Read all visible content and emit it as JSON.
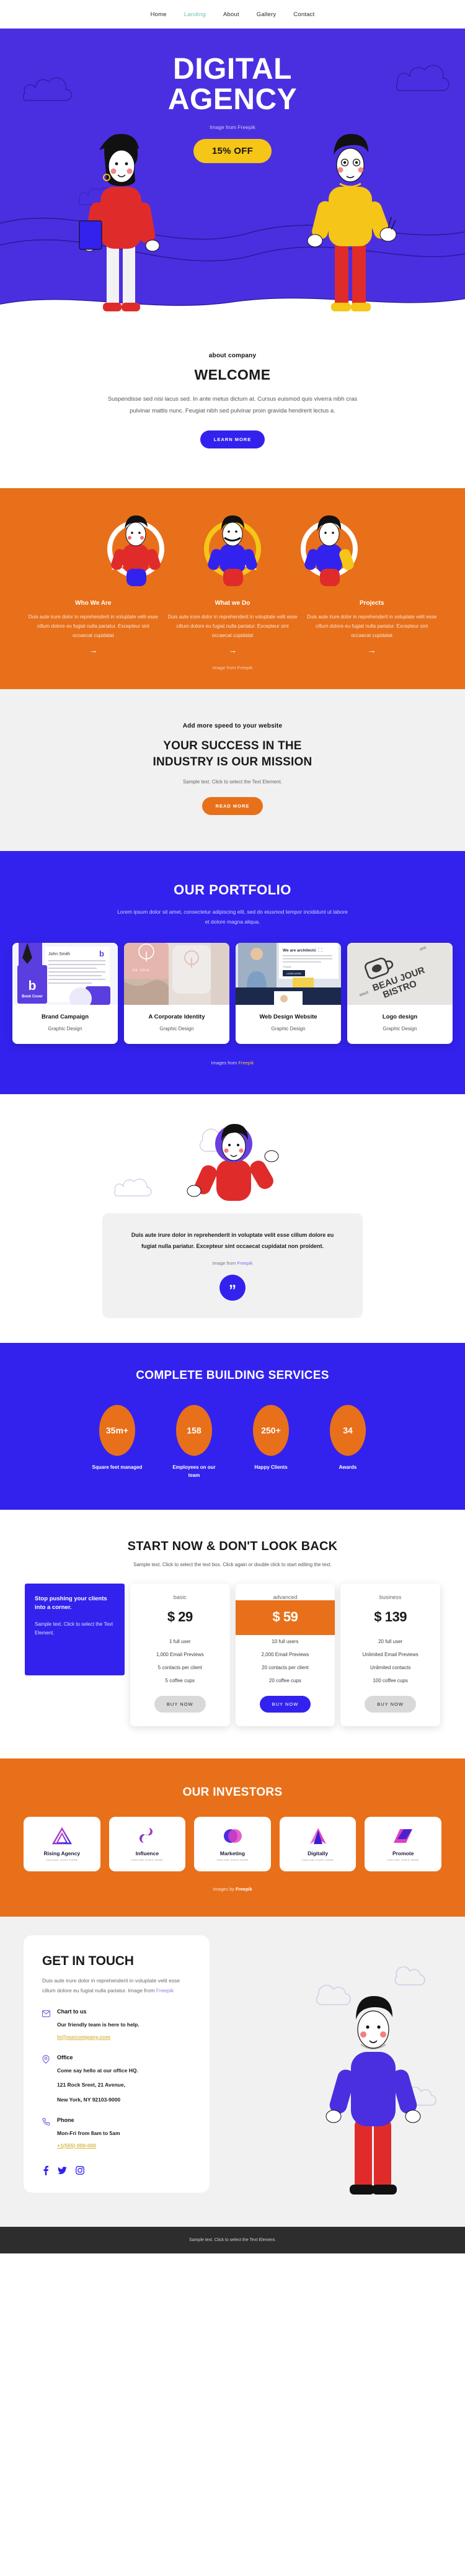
{
  "nav": {
    "items": [
      {
        "label": "Home",
        "active": false
      },
      {
        "label": "Landing",
        "active": true
      },
      {
        "label": "About",
        "active": false
      },
      {
        "label": "Gallery",
        "active": false
      },
      {
        "label": "Contact",
        "active": false
      }
    ]
  },
  "hero": {
    "title_line1": "DIGITAL",
    "title_line2": "AGENCY",
    "credit": "Image from Freepik",
    "badge": "15% OFF",
    "bg_color": "#4a2fe0",
    "badge_color": "#f5c518"
  },
  "welcome": {
    "eyebrow": "about company",
    "heading": "WELCOME",
    "body": "Suspendisse sed nisi lacus sed. In ante metus dictum at. Cursus euismod quis viverra nibh cras pulvinar mattis nunc. Feugiat nibh sed pulvinar proin gravida hendrerit lectus a.",
    "button": "LEARN MORE"
  },
  "features": {
    "bg_color": "#e8701a",
    "credit": "Image from Freepik",
    "items": [
      {
        "title": "Who We Are",
        "body": "Duis aute irure dolor in reprehenderit in voluptate velit esse cillum dolore eu fugiat nulla pariatur. Excepteur sint occaecat cupidatat",
        "arrow": "→"
      },
      {
        "title": "What we Do",
        "body": "Duis aute irure dolor in reprehenderit in voluptate velit esse cillum dolore eu fugiat nulla pariatur. Excepteur sint occaecat cupidatat",
        "arrow": "→"
      },
      {
        "title": "Projects",
        "body": "Duis aute irure dolor in reprehenderit in voluptate velit esse cillum dolore eu fugiat nulla pariatur. Excepteur sint occaecat cupidatat",
        "arrow": "→"
      }
    ]
  },
  "mission": {
    "eyebrow": "Add more speed to your website",
    "heading_line1": "YOUR SUCCESS IN THE",
    "heading_line2": "INDUSTRY IS OUR MISSION",
    "sub": "Sample text. Click to select the Text Element.",
    "button": "READ MORE"
  },
  "portfolio": {
    "heading": "OUR PORTFOLIO",
    "lead": "Lorem ipsum dolor sit amet, consectetur adipiscing elit, sed do eiusmod tempor incididunt ut labore et dolore magna aliqua.",
    "credit_prefix": "Images from ",
    "credit_link": "Freepik",
    "cards": [
      {
        "title": "Brand Campaign",
        "category": "Graphic Design",
        "thumb_label": "Book Cover",
        "thumb_name": "John Smith"
      },
      {
        "title": "A Corporate Identity",
        "category": "Graphic Design",
        "thumb_label": "DE VOID"
      },
      {
        "title": "Web Design Website",
        "category": "Graphic Design",
        "thumb_label": "We are architects",
        "thumb_cta": "LEARN MORE"
      },
      {
        "title": "Logo design",
        "category": "Graphic Design",
        "thumb_label": "BEAU JOUR BISTRO",
        "thumb_since": "SINCE",
        "thumb_year": "1970"
      }
    ]
  },
  "quote": {
    "text": "Duis aute irure dolor in reprehenderit in voluptate velit esse cillum dolore eu fugiat nulla pariatur. Excepteur sint occaecat cupidatat non proident.",
    "credit_prefix": "Image from ",
    "credit_link": "Freepik",
    "mark": "”"
  },
  "stats": {
    "heading": "COMPLETE BUILDING SERVICES",
    "bg_color": "#3322ee",
    "bubble_color": "#e8701a",
    "items": [
      {
        "value": "35m+",
        "label": "Square feet managed"
      },
      {
        "value": "158",
        "label": "Employees on our team"
      },
      {
        "value": "250+",
        "label": "Happy Clients"
      },
      {
        "value": "34",
        "label": "Awards"
      }
    ]
  },
  "pricing": {
    "heading": "START NOW & DON'T LOOK BACK",
    "sub": "Sample text. Click to select the text box. Click again or double click to start editing the text.",
    "promo": {
      "title": "Stop pushing your clients into a corner.",
      "body": "Sample text. Click to select the Text Element."
    },
    "plans": [
      {
        "tier": "basic",
        "price": "$ 29",
        "featured": false,
        "features": [
          "1 full user",
          "1,000 Email Previews",
          "5 contacts per client",
          "5 coffee cups"
        ],
        "button": "BUY NOW"
      },
      {
        "tier": "advanced",
        "price": "$ 59",
        "featured": true,
        "features": [
          "10 full users",
          "2,000 Email Previews",
          "20 contacts per client",
          "20 coffee cups"
        ],
        "button": "BUY NOW"
      },
      {
        "tier": "business",
        "price": "$ 139",
        "featured": false,
        "features": [
          "20 full user",
          "Unlimited Email Previews",
          "Unlimited contacts",
          "100 coffee cups"
        ],
        "button": "BUY NOW"
      }
    ]
  },
  "investors": {
    "heading": "OUR INVESTORS",
    "credit_prefix": "Images by ",
    "credit_link": "Freepik",
    "items": [
      {
        "name": "Rising Agency",
        "tagline": "TAGLINE GOES HERE"
      },
      {
        "name": "Influence",
        "tagline": "TAGLINE GOES HERE"
      },
      {
        "name": "Marketing",
        "tagline": "TAGLINE GOES HERE"
      },
      {
        "name": "Digitally",
        "tagline": "TAGLINE GOES HERE"
      },
      {
        "name": "Promote",
        "tagline": "TAGLINE GOES HERE"
      }
    ]
  },
  "contact": {
    "heading": "GET IN TOUCH",
    "intro_text": "Duis aute irure dolor in reprehenderit in voluptate velit esse cillum dolore eu fugiat nulla pariatur. Image from ",
    "intro_link": "Freepik",
    "blocks": [
      {
        "icon": "mail-icon",
        "title": "Chart to us",
        "body": "Our friendly team is here to help.",
        "link": "hi@ourcompany.com"
      },
      {
        "icon": "location-pin-icon",
        "title": "Office",
        "body": "Come say hello at our office HQ.",
        "body2": "121 Rock Sreet, 21 Avenue,",
        "body3": "New York, NY 92103-9000",
        "link": ""
      },
      {
        "icon": "phone-icon",
        "title": "Phone",
        "body": "Mon-Fri from 8am to 5am",
        "link": "+1(555) 000-000"
      }
    ],
    "socials": [
      "facebook-icon",
      "twitter-icon",
      "instagram-icon"
    ]
  },
  "footer": {
    "text": "Sample text. Click to select the Text Element."
  }
}
